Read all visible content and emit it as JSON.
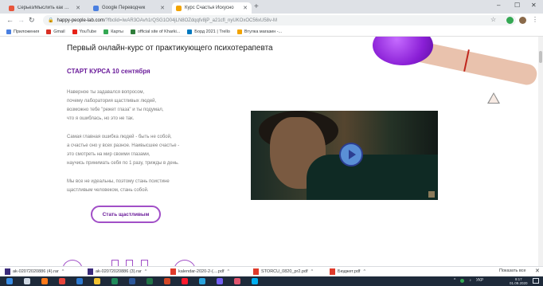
{
  "browser": {
    "tabs": [
      {
        "title": "Серьез/Мыслить как преступ...",
        "fav_color": "#e8553b",
        "active": false
      },
      {
        "title": "Google Переводчик",
        "fav_color": "#4a7fe0",
        "active": false
      },
      {
        "title": "Курс Счастья Искусно",
        "fav_color": "#f2a300",
        "active": true
      }
    ],
    "new_tab": "+",
    "window_controls": {
      "minimize": "–",
      "maximize": "☐",
      "close": "✕"
    },
    "nav": {
      "back": "←",
      "forward": "→",
      "reload": "↻"
    },
    "url_host": "happy-people-lab.com",
    "url_path": "/?fbclid=IwAR3OAvh1rQSG1O04jLN8OZdqqfv8jP_a21cfl_nyUKOxOC56xU58v-M",
    "star": "☆",
    "bookmarks": [
      {
        "label": "Приложения",
        "color": "#4a7fe0"
      },
      {
        "label": "Gmail",
        "color": "#d93025"
      },
      {
        "label": "YouTube",
        "color": "#e62117"
      },
      {
        "label": "Карты",
        "color": "#34a853"
      },
      {
        "label": "official site of Kharki...",
        "color": "#2f7d3a"
      },
      {
        "label": "Борд 2021 | Trello",
        "color": "#0079bf"
      },
      {
        "label": "Втулка магазин -...",
        "color": "#f2a300"
      }
    ]
  },
  "page": {
    "headline": "Первый онлайн-курс от практикующего психотерапевта",
    "start_label": "СТАРТ КУРСА 10 сентября",
    "paragraphs": [
      [
        "Наверное ты задавался вопросом,",
        "почему лаборатория щастливых людей,",
        "возможно тебе \"режет глаза\" и ты подумал,",
        "что я ошиблась, но это не так."
      ],
      [
        "Самая главная ошибка людей - быть не собой,",
        "а счастье оно у всех разное. Наивысшее счастье -",
        "это смотреть на мир своими глазами,",
        "научись принимать себя по 1 разу, трижды в день."
      ],
      [
        "Мы все не идеальны, поэтому стань поистине",
        "щастливым человеком, стань собой."
      ]
    ],
    "cta_label": "Стать щастливым",
    "colors": {
      "accent": "#6a1b9a",
      "cta_border": "#a14fc7",
      "play_button": "#5a8fd6"
    }
  },
  "downloads": {
    "items": [
      {
        "name": "ak-02072020886 (4).rar",
        "color": "#3a2a7a"
      },
      {
        "name": "ak-02072020886 (3).rar",
        "color": "#3a2a7a"
      },
      {
        "name": "kalendar-2020-2-(....pdf",
        "color": "#e03a2a"
      },
      {
        "name": "STORCU_0820_pr2.pdf",
        "color": "#e03a2a"
      },
      {
        "name": "Бюджет.pdf",
        "color": "#e03a2a"
      }
    ],
    "caret": "^",
    "show_all": "Показать все",
    "close": "✕"
  },
  "taskbar": {
    "apps": [
      {
        "name": "windows-start-icon",
        "color": "#3a8ee6"
      },
      {
        "name": "task-view-icon",
        "color": "#cfd8e3"
      },
      {
        "name": "firefox-icon",
        "color": "#ff7a1a"
      },
      {
        "name": "chrome-icon",
        "color": "#e8453c"
      },
      {
        "name": "edge-icon",
        "color": "#2e7ad1"
      },
      {
        "name": "files-icon",
        "color": "#f2c230"
      },
      {
        "name": "media-icon",
        "color": "#1f8a5a"
      },
      {
        "name": "word-icon",
        "color": "#2b579a"
      },
      {
        "name": "excel-icon",
        "color": "#217346"
      },
      {
        "name": "powerpoint-icon",
        "color": "#d24726"
      },
      {
        "name": "opera-icon",
        "color": "#ff1b2d"
      },
      {
        "name": "telegram-icon",
        "color": "#2aa3dd"
      },
      {
        "name": "viber-icon",
        "color": "#7360f2"
      },
      {
        "name": "paint-icon",
        "color": "#e0556e"
      },
      {
        "name": "skype-icon",
        "color": "#00aff0"
      }
    ],
    "tray_lang": "УКР",
    "time": "9:17",
    "date": "01.09.2020"
  }
}
